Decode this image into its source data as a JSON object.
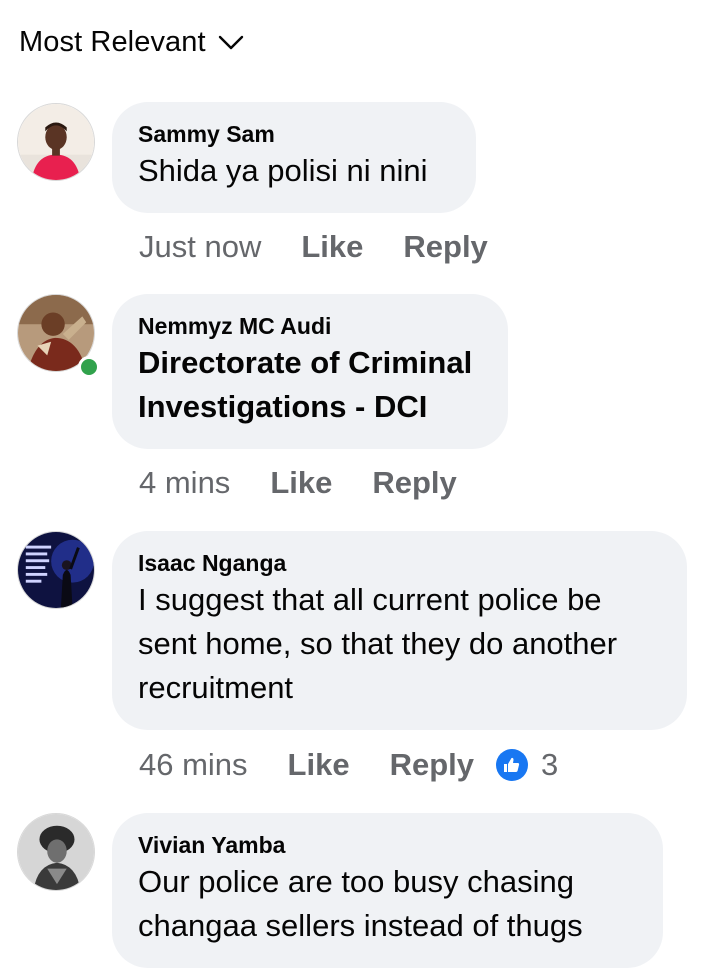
{
  "sort": {
    "label": "Most Relevant"
  },
  "comments": [
    {
      "author": "Sammy Sam",
      "text": "Shida ya polisi ni nini",
      "time": "Just now",
      "like_label": "Like",
      "reply_label": "Reply"
    },
    {
      "author": "Nemmyz MC Audi",
      "text_line1": "Directorate of Criminal",
      "text_line2": "Investigations - DCI",
      "time": "4 mins",
      "like_label": "Like",
      "reply_label": "Reply",
      "online": true
    },
    {
      "author": "Isaac Nganga",
      "text": "I suggest that all current police be sent home, so that they do another recruitment",
      "time": "46 mins",
      "like_label": "Like",
      "reply_label": "Reply",
      "reaction_count": "3"
    },
    {
      "author": "Vivian Yamba",
      "text": "Our police are too busy chasing changaa sellers instead of thugs"
    }
  ],
  "colors": {
    "bubble_bg": "#f0f2f5",
    "secondary_text": "#65676b",
    "online_green": "#31a24c",
    "like_blue": "#1877f2"
  }
}
